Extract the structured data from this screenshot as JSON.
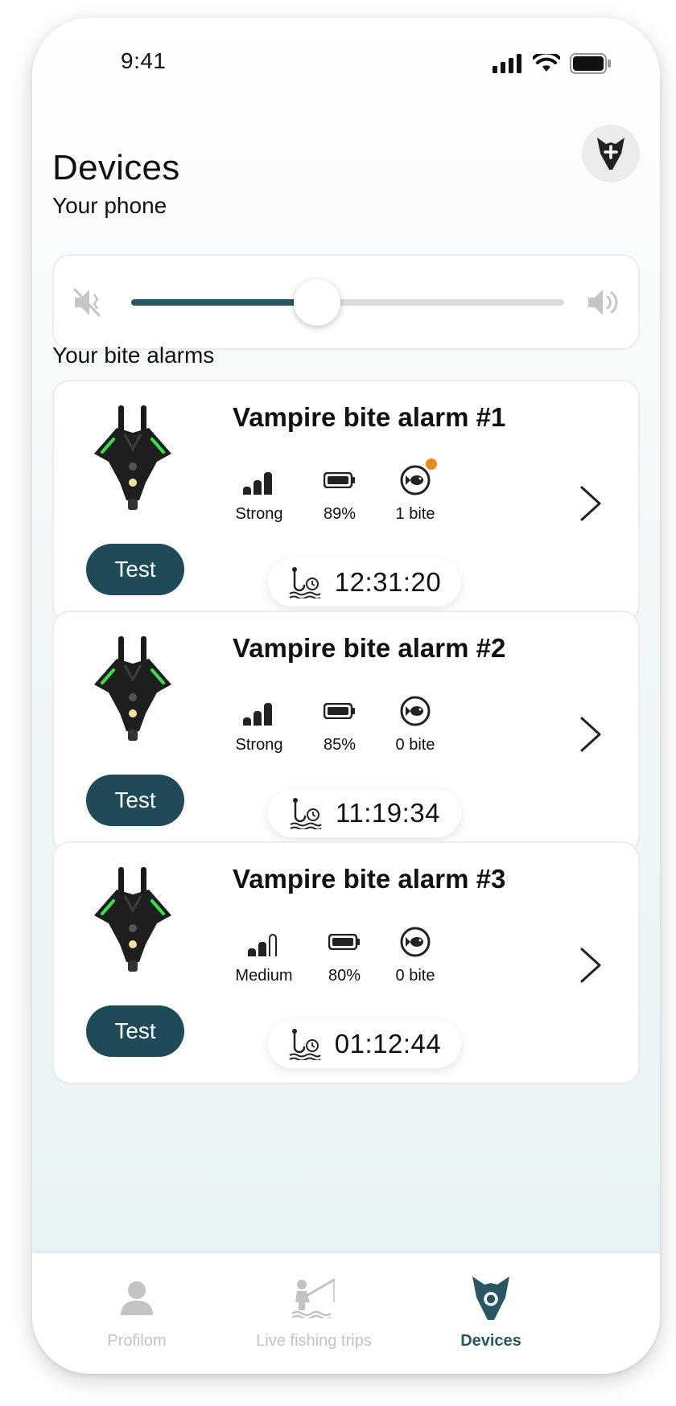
{
  "status_bar": {
    "time": "9:41"
  },
  "header": {
    "title": "Devices"
  },
  "phone_section": {
    "label": "Your phone",
    "volume_level": 0.43
  },
  "alarms_section": {
    "label": "Your bite alarms"
  },
  "test_label": "Test",
  "alarms": [
    {
      "name": "Vampire bite alarm #1",
      "signal": "Strong",
      "battery": "89%",
      "bites": "1 bite",
      "time": "12:31:20",
      "has_new_bite": true
    },
    {
      "name": "Vampire bite alarm #2",
      "signal": "Strong",
      "battery": "85%",
      "bites": "0 bite",
      "time": "11:19:34",
      "has_new_bite": false
    },
    {
      "name": "Vampire bite alarm #3",
      "signal": "Medium",
      "battery": "80%",
      "bites": "0 bite",
      "time": "01:12:44",
      "has_new_bite": false
    }
  ],
  "tab_bar": {
    "tabs": [
      {
        "label": "Profilom",
        "icon": "person-icon",
        "active": false
      },
      {
        "label": "Live fishing trips",
        "icon": "fisherman-icon",
        "active": false
      },
      {
        "label": "Devices",
        "icon": "bite-alarm-icon",
        "active": true
      }
    ]
  },
  "colors": {
    "accent": "#2a5563",
    "button": "#1f4a58",
    "badge": "#f08a1b",
    "inactive": "#c3c3c3"
  }
}
